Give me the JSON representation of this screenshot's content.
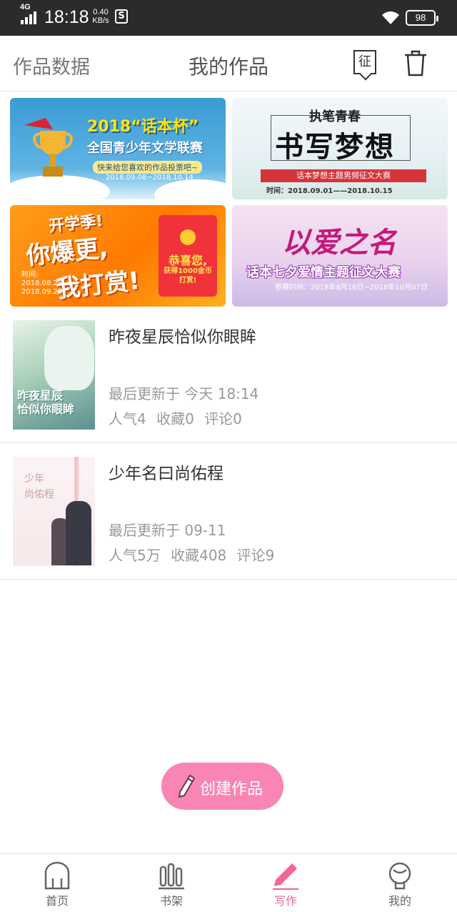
{
  "status_bar": {
    "network": "4G",
    "time": "18:18",
    "speed_value": "0.40",
    "speed_unit": "KB/s",
    "s_badge": "S",
    "battery": "98"
  },
  "header": {
    "left_label": "作品数据",
    "title": "我的作品",
    "zheng_icon": "征"
  },
  "banners": [
    {
      "line1": "2018“话本杯”",
      "line2": "全国青少年文学联赛",
      "line3": "快来给您喜欢的作品投票吧~",
      "line4": "2018.09.08~2018.10.14"
    },
    {
      "line1": "执笔青春",
      "line2": "书写梦想",
      "line3": "话本梦想主题男频征文大赛",
      "line4": "时间：2018.09.01——2018.10.15"
    },
    {
      "line1": "开学季!",
      "line2": "你爆更,",
      "line3": "我打赏!",
      "line4": "时间:",
      "line5": "2018.08.25~",
      "line6": "2018.09.25",
      "envelope1": "恭喜您,",
      "envelope2": "获得1000金币",
      "envelope3": "打赏!"
    },
    {
      "line1": "以爱之名",
      "line2": "话本七夕爱情主题征文大赛",
      "line3": "参赛时间：2018年8月16日~2018年10月07日"
    }
  ],
  "works": [
    {
      "title": "昨夜星辰恰似你眼眸",
      "cover_line1": "昨夜星辰",
      "cover_line2": "恰似你眼眸",
      "update_label": "最后更新于",
      "update_time": "今天 18:14",
      "popularity": "人气4",
      "favorites": "收藏0",
      "comments": "评论0"
    },
    {
      "title": "少年名曰尚佑程",
      "cover_line1": "少年",
      "cover_line2": "尚佑程",
      "update_label": "最后更新于",
      "update_time": "09-11",
      "popularity": "人气5万",
      "favorites": "收藏408",
      "comments": "评论9"
    }
  ],
  "create_button": {
    "label": "创建作品",
    "color": "#f985b4"
  },
  "tabs": [
    {
      "label": "首页",
      "icon": "home-icon"
    },
    {
      "label": "书架",
      "icon": "bookshelf-icon"
    },
    {
      "label": "写作",
      "icon": "pen-icon",
      "active": true
    },
    {
      "label": "我的",
      "icon": "profile-icon"
    }
  ],
  "colors": {
    "accent": "#f0679a",
    "status_bar": "#2b2b2b"
  }
}
